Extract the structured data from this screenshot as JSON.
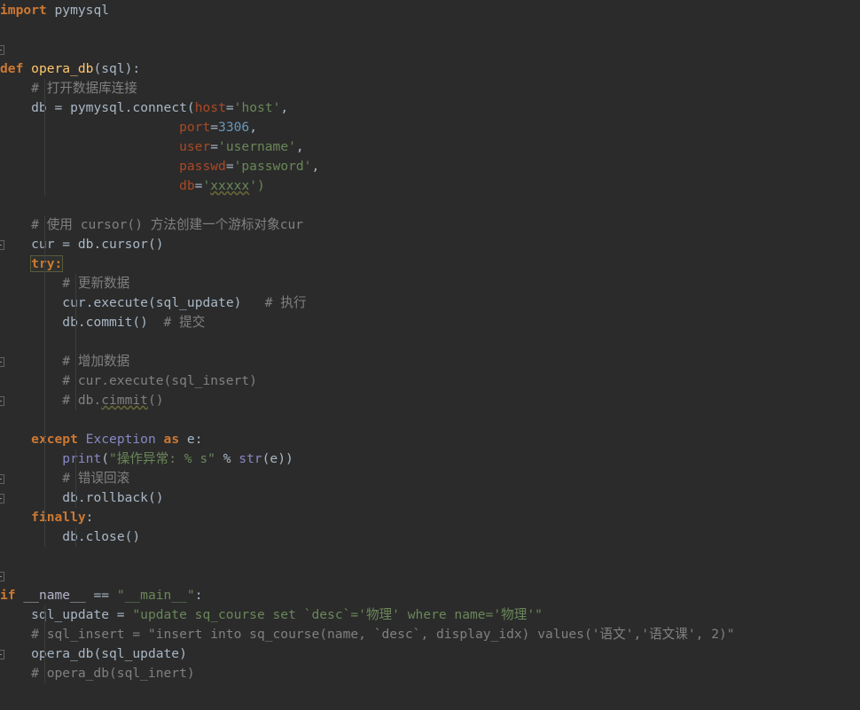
{
  "editor": {
    "language": "Python",
    "theme": "Darcula",
    "background": "#2b2b2b",
    "default_text_color": "#a9b7c6",
    "colors": {
      "keyword": "#cc7832",
      "function_name": "#ffc66d",
      "comment": "#808080",
      "string": "#6a8759",
      "number": "#6897bb",
      "keyword_argument": "#aa4926",
      "builtin": "#8888c6",
      "identifier": "#a9b7c6"
    }
  },
  "gutter": {
    "fold_markers": [
      {
        "line": 3,
        "state": "expanded",
        "icon": "fold-minus-icon"
      },
      {
        "line": 13,
        "state": "expanded",
        "icon": "fold-minus-icon"
      },
      {
        "line": 19,
        "state": "collapsed",
        "icon": "fold-plus-icon"
      },
      {
        "line": 21,
        "state": "expanded",
        "icon": "fold-minus-icon"
      },
      {
        "line": 25,
        "state": "expanded",
        "icon": "fold-plus-icon"
      },
      {
        "line": 26,
        "state": "collapsed",
        "icon": "fold-plus-icon"
      },
      {
        "line": 30,
        "state": "expanded",
        "icon": "fold-minus-icon"
      },
      {
        "line": 34,
        "state": "collapsed",
        "icon": "fold-plus-icon"
      }
    ]
  },
  "code": {
    "lines": [
      {
        "n": 1,
        "tokens": [
          {
            "t": "import",
            "c": "kw"
          },
          {
            "t": " ",
            "c": "punct"
          },
          {
            "t": "pymysql",
            "c": "ident"
          }
        ]
      },
      {
        "n": 2,
        "tokens": []
      },
      {
        "n": 3,
        "tokens": []
      },
      {
        "n": 4,
        "tokens": [
          {
            "t": "def",
            "c": "kw"
          },
          {
            "t": " ",
            "c": "punct"
          },
          {
            "t": "opera_db",
            "c": "def-name"
          },
          {
            "t": "(",
            "c": "punct"
          },
          {
            "t": "sql",
            "c": "param"
          },
          {
            "t": "):",
            "c": "punct"
          }
        ]
      },
      {
        "n": 5,
        "tokens": [
          {
            "t": "    # 打开数据库连接",
            "c": "comment"
          }
        ]
      },
      {
        "n": 6,
        "tokens": [
          {
            "t": "    db ",
            "c": "ident"
          },
          {
            "t": "= ",
            "c": "op"
          },
          {
            "t": "pymysql",
            "c": "ident"
          },
          {
            "t": ".",
            "c": "punct"
          },
          {
            "t": "connect",
            "c": "ident"
          },
          {
            "t": "(",
            "c": "punct"
          },
          {
            "t": "host",
            "c": "kwarg"
          },
          {
            "t": "=",
            "c": "op"
          },
          {
            "t": "'host'",
            "c": "str"
          },
          {
            "t": ",",
            "c": "punct"
          }
        ]
      },
      {
        "n": 7,
        "tokens": [
          {
            "t": "                       ",
            "c": "punct"
          },
          {
            "t": "port",
            "c": "kwarg"
          },
          {
            "t": "=",
            "c": "op"
          },
          {
            "t": "3306",
            "c": "num"
          },
          {
            "t": ",",
            "c": "punct"
          }
        ]
      },
      {
        "n": 8,
        "tokens": [
          {
            "t": "                       ",
            "c": "punct"
          },
          {
            "t": "user",
            "c": "kwarg"
          },
          {
            "t": "=",
            "c": "op"
          },
          {
            "t": "'username'",
            "c": "str"
          },
          {
            "t": ",",
            "c": "punct"
          }
        ]
      },
      {
        "n": 9,
        "tokens": [
          {
            "t": "                       ",
            "c": "punct"
          },
          {
            "t": "passwd",
            "c": "kwarg"
          },
          {
            "t": "=",
            "c": "op"
          },
          {
            "t": "'password'",
            "c": "str"
          },
          {
            "t": ",",
            "c": "punct"
          }
        ]
      },
      {
        "n": 10,
        "tokens": [
          {
            "t": "                       ",
            "c": "punct"
          },
          {
            "t": "db",
            "c": "kwarg"
          },
          {
            "t": "=",
            "c": "op"
          },
          {
            "t": "'",
            "c": "str"
          },
          {
            "t": "xxxxx",
            "c": "str typo"
          },
          {
            "t": "')",
            "c": "str"
          }
        ]
      },
      {
        "n": 11,
        "tokens": []
      },
      {
        "n": 12,
        "tokens": [
          {
            "t": "    # 使用 cursor() 方法创建一个游标对象cur",
            "c": "comment"
          }
        ]
      },
      {
        "n": 13,
        "tokens": [
          {
            "t": "    cur ",
            "c": "ident"
          },
          {
            "t": "= ",
            "c": "op"
          },
          {
            "t": "db",
            "c": "ident"
          },
          {
            "t": ".",
            "c": "punct"
          },
          {
            "t": "cursor",
            "c": "ident"
          },
          {
            "t": "()",
            "c": "punct"
          }
        ]
      },
      {
        "n": 14,
        "tokens": [
          {
            "t": "    ",
            "c": "punct"
          },
          {
            "t": "try:",
            "c": "kw caret-hl"
          }
        ]
      },
      {
        "n": 15,
        "tokens": [
          {
            "t": "        # 更新数据",
            "c": "comment"
          }
        ]
      },
      {
        "n": 16,
        "tokens": [
          {
            "t": "        cur",
            "c": "ident"
          },
          {
            "t": ".",
            "c": "punct"
          },
          {
            "t": "execute",
            "c": "ident"
          },
          {
            "t": "(",
            "c": "punct"
          },
          {
            "t": "sql_update",
            "c": "ident"
          },
          {
            "t": ")",
            "c": "punct"
          },
          {
            "t": "   # 执行",
            "c": "comment"
          }
        ]
      },
      {
        "n": 17,
        "tokens": [
          {
            "t": "        db",
            "c": "ident"
          },
          {
            "t": ".",
            "c": "punct"
          },
          {
            "t": "commit",
            "c": "ident"
          },
          {
            "t": "()",
            "c": "punct"
          },
          {
            "t": "  # 提交",
            "c": "comment"
          }
        ]
      },
      {
        "n": 18,
        "tokens": []
      },
      {
        "n": 19,
        "tokens": [
          {
            "t": "        # 增加数据",
            "c": "comment"
          }
        ]
      },
      {
        "n": 20,
        "tokens": [
          {
            "t": "        # cur.execute(sql_insert)",
            "c": "comment"
          }
        ]
      },
      {
        "n": 21,
        "tokens": [
          {
            "t": "        # db.",
            "c": "comment"
          },
          {
            "t": "cimmit",
            "c": "comment typo"
          },
          {
            "t": "()",
            "c": "comment"
          }
        ]
      },
      {
        "n": 22,
        "tokens": []
      },
      {
        "n": 23,
        "tokens": [
          {
            "t": "    ",
            "c": "punct"
          },
          {
            "t": "except",
            "c": "kw"
          },
          {
            "t": " ",
            "c": "punct"
          },
          {
            "t": "Exception",
            "c": "builtin"
          },
          {
            "t": " ",
            "c": "punct"
          },
          {
            "t": "as",
            "c": "kw"
          },
          {
            "t": " e:",
            "c": "ident"
          }
        ]
      },
      {
        "n": 24,
        "tokens": [
          {
            "t": "        ",
            "c": "punct"
          },
          {
            "t": "print",
            "c": "builtin"
          },
          {
            "t": "(",
            "c": "punct"
          },
          {
            "t": "\"操作异常: ",
            "c": "str"
          },
          {
            "t": "% s",
            "c": "fmt"
          },
          {
            "t": "\" ",
            "c": "str"
          },
          {
            "t": "% ",
            "c": "op"
          },
          {
            "t": "str",
            "c": "builtin"
          },
          {
            "t": "(e))",
            "c": "punct"
          }
        ]
      },
      {
        "n": 25,
        "tokens": [
          {
            "t": "        # 错误回滚",
            "c": "comment"
          }
        ]
      },
      {
        "n": 26,
        "tokens": [
          {
            "t": "        db",
            "c": "ident"
          },
          {
            "t": ".",
            "c": "punct"
          },
          {
            "t": "rollback",
            "c": "ident"
          },
          {
            "t": "()",
            "c": "punct"
          }
        ]
      },
      {
        "n": 27,
        "tokens": [
          {
            "t": "    ",
            "c": "punct"
          },
          {
            "t": "finally",
            "c": "kw"
          },
          {
            "t": ":",
            "c": "punct"
          }
        ]
      },
      {
        "n": 28,
        "tokens": [
          {
            "t": "        db",
            "c": "ident"
          },
          {
            "t": ".",
            "c": "punct"
          },
          {
            "t": "close",
            "c": "ident"
          },
          {
            "t": "()",
            "c": "punct"
          }
        ]
      },
      {
        "n": 29,
        "tokens": []
      },
      {
        "n": 30,
        "tokens": []
      },
      {
        "n": 31,
        "tokens": [
          {
            "t": "if",
            "c": "kw"
          },
          {
            "t": " ",
            "c": "punct"
          },
          {
            "t": "__name__",
            "c": "dunder"
          },
          {
            "t": " == ",
            "c": "op"
          },
          {
            "t": "\"__main__\"",
            "c": "str"
          },
          {
            "t": ":",
            "c": "punct"
          }
        ]
      },
      {
        "n": 32,
        "tokens": [
          {
            "t": "    sql_update ",
            "c": "ident"
          },
          {
            "t": "= ",
            "c": "op"
          },
          {
            "t": "\"update sq_course set `desc`='物理' where name='物理'\"",
            "c": "str"
          }
        ]
      },
      {
        "n": 33,
        "tokens": [
          {
            "t": "    # sql_insert = \"insert into sq_course(name, `desc`, display_idx) values('语文','语文课', 2)\"",
            "c": "comment"
          }
        ]
      },
      {
        "n": 34,
        "tokens": [
          {
            "t": "    opera_db",
            "c": "ident"
          },
          {
            "t": "(",
            "c": "punct"
          },
          {
            "t": "sql_update",
            "c": "ident"
          },
          {
            "t": ")",
            "c": "punct"
          }
        ]
      },
      {
        "n": 35,
        "tokens": [
          {
            "t": "    # opera_db(sql_inert)",
            "c": "comment"
          }
        ]
      }
    ],
    "plain_text": "import pymysql\n\n\ndef opera_db(sql):\n    # 打开数据库连接\n    db = pymysql.connect(host='host',\n                       port=3306,\n                       user='username',\n                       passwd='password',\n                       db='xxxxx')\n\n    # 使用 cursor() 方法创建一个游标对象cur\n    cur = db.cursor()\n    try:\n        # 更新数据\n        cur.execute(sql_update)   # 执行\n        db.commit()  # 提交\n\n        # 增加数据\n        # cur.execute(sql_insert)\n        # db.cimmit()\n\n    except Exception as e:\n        print(\"操作异常: % s\" % str(e))\n        # 错误回滚\n        db.rollback()\n    finally:\n        db.close()\n\n\nif __name__ == \"__main__\":\n    sql_update = \"update sq_course set `desc`='物理' where name='物理'\"\n    # sql_insert = \"insert into sq_course(name, `desc`, display_idx) values('语文','语文课', 2)\"\n    opera_db(sql_update)\n    # opera_db(sql_inert)"
  }
}
